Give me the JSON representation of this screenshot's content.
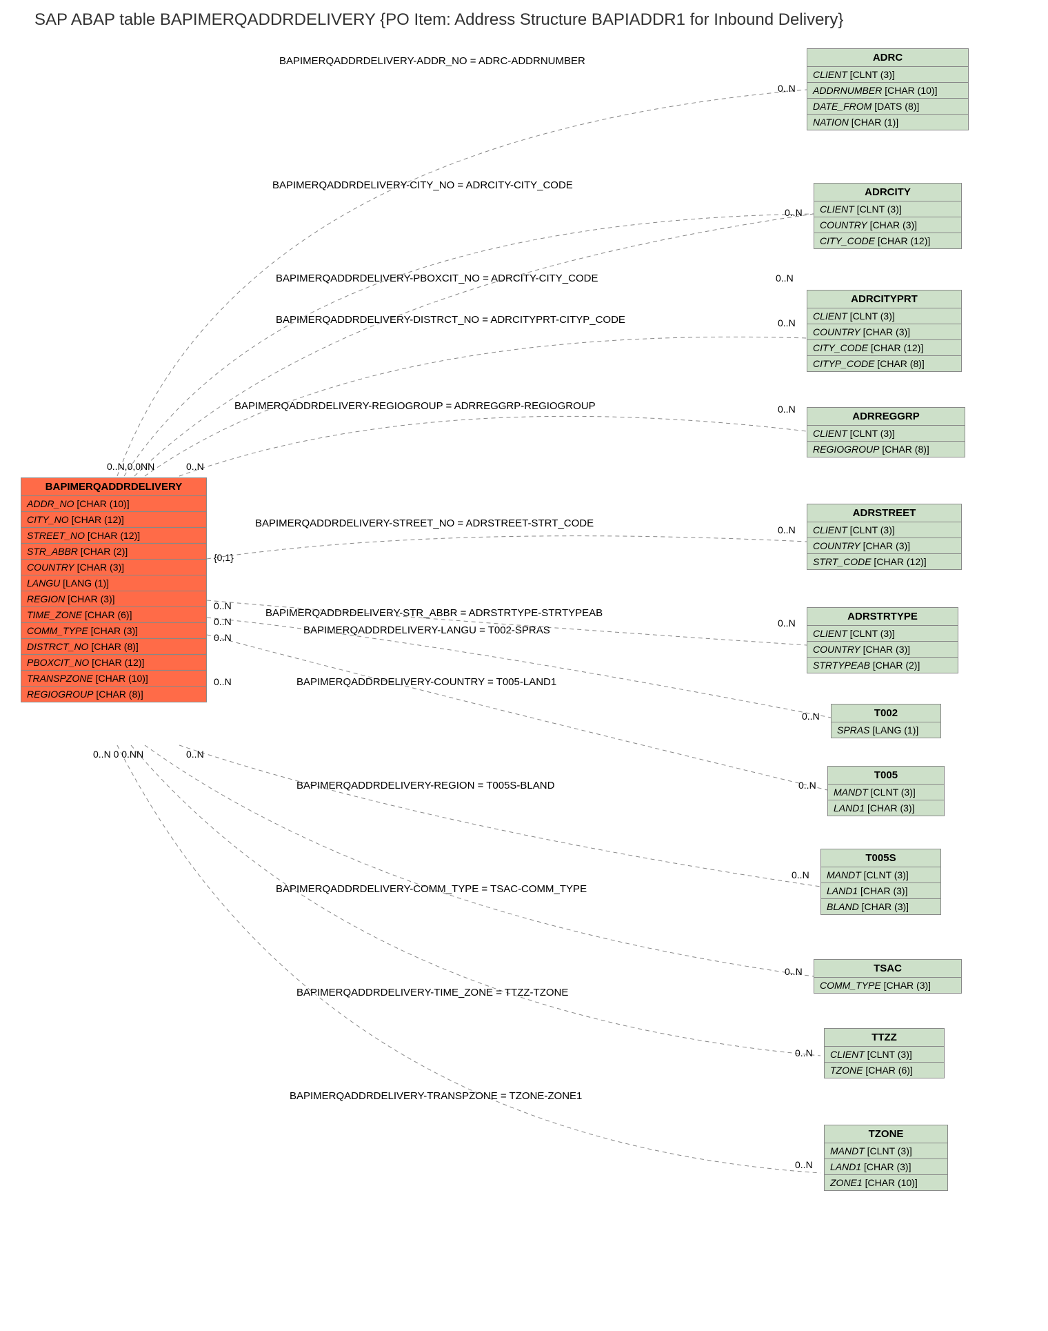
{
  "title": "SAP ABAP table BAPIMERQADDRDELIVERY {PO Item: Address Structure BAPIADDR1 for Inbound Delivery}",
  "main": {
    "name": "BAPIMERQADDRDELIVERY",
    "fields": [
      {
        "n": "ADDR_NO",
        "t": "[CHAR (10)]"
      },
      {
        "n": "CITY_NO",
        "t": "[CHAR (12)]"
      },
      {
        "n": "STREET_NO",
        "t": "[CHAR (12)]"
      },
      {
        "n": "STR_ABBR",
        "t": "[CHAR (2)]"
      },
      {
        "n": "COUNTRY",
        "t": "[CHAR (3)]"
      },
      {
        "n": "LANGU",
        "t": "[LANG (1)]"
      },
      {
        "n": "REGION",
        "t": "[CHAR (3)]"
      },
      {
        "n": "TIME_ZONE",
        "t": "[CHAR (6)]"
      },
      {
        "n": "COMM_TYPE",
        "t": "[CHAR (3)]"
      },
      {
        "n": "DISTRCT_NO",
        "t": "[CHAR (8)]"
      },
      {
        "n": "PBOXCIT_NO",
        "t": "[CHAR (12)]"
      },
      {
        "n": "TRANSPZONE",
        "t": "[CHAR (10)]"
      },
      {
        "n": "REGIOGROUP",
        "t": "[CHAR (8)]"
      }
    ]
  },
  "refs": [
    {
      "name": "ADRC",
      "fields": [
        {
          "n": "CLIENT",
          "t": "[CLNT (3)]"
        },
        {
          "n": "ADDRNUMBER",
          "t": "[CHAR (10)]"
        },
        {
          "n": "DATE_FROM",
          "t": "[DATS (8)]"
        },
        {
          "n": "NATION",
          "t": "[CHAR (1)]"
        }
      ]
    },
    {
      "name": "ADRCITY",
      "fields": [
        {
          "n": "CLIENT",
          "t": "[CLNT (3)]"
        },
        {
          "n": "COUNTRY",
          "t": "[CHAR (3)]"
        },
        {
          "n": "CITY_CODE",
          "t": "[CHAR (12)]"
        }
      ]
    },
    {
      "name": "ADRCITYPRT",
      "fields": [
        {
          "n": "CLIENT",
          "t": "[CLNT (3)]"
        },
        {
          "n": "COUNTRY",
          "t": "[CHAR (3)]"
        },
        {
          "n": "CITY_CODE",
          "t": "[CHAR (12)]"
        },
        {
          "n": "CITYP_CODE",
          "t": "[CHAR (8)]"
        }
      ]
    },
    {
      "name": "ADRREGGRP",
      "fields": [
        {
          "n": "CLIENT",
          "t": "[CLNT (3)]"
        },
        {
          "n": "REGIOGROUP",
          "t": "[CHAR (8)]"
        }
      ]
    },
    {
      "name": "ADRSTREET",
      "fields": [
        {
          "n": "CLIENT",
          "t": "[CLNT (3)]"
        },
        {
          "n": "COUNTRY",
          "t": "[CHAR (3)]"
        },
        {
          "n": "STRT_CODE",
          "t": "[CHAR (12)]"
        }
      ]
    },
    {
      "name": "ADRSTRTYPE",
      "fields": [
        {
          "n": "CLIENT",
          "t": "[CLNT (3)]"
        },
        {
          "n": "COUNTRY",
          "t": "[CHAR (3)]"
        },
        {
          "n": "STRTYPEAB",
          "t": "[CHAR (2)]"
        }
      ]
    },
    {
      "name": "T002",
      "fields": [
        {
          "n": "SPRAS",
          "t": "[LANG (1)]"
        }
      ]
    },
    {
      "name": "T005",
      "fields": [
        {
          "n": "MANDT",
          "t": "[CLNT (3)]"
        },
        {
          "n": "LAND1",
          "t": "[CHAR (3)]"
        }
      ]
    },
    {
      "name": "T005S",
      "fields": [
        {
          "n": "MANDT",
          "t": "[CLNT (3)]"
        },
        {
          "n": "LAND1",
          "t": "[CHAR (3)]"
        },
        {
          "n": "BLAND",
          "t": "[CHAR (3)]"
        }
      ]
    },
    {
      "name": "TSAC",
      "fields": [
        {
          "n": "COMM_TYPE",
          "t": "[CHAR (3)]"
        }
      ]
    },
    {
      "name": "TTZZ",
      "fields": [
        {
          "n": "CLIENT",
          "t": "[CLNT (3)]"
        },
        {
          "n": "TZONE",
          "t": "[CHAR (6)]"
        }
      ]
    },
    {
      "name": "TZONE",
      "fields": [
        {
          "n": "MANDT",
          "t": "[CLNT (3)]"
        },
        {
          "n": "LAND1",
          "t": "[CHAR (3)]"
        },
        {
          "n": "ZONE1",
          "t": "[CHAR (10)]"
        }
      ]
    }
  ],
  "rels": [
    "BAPIMERQADDRDELIVERY-ADDR_NO = ADRC-ADDRNUMBER",
    "BAPIMERQADDRDELIVERY-CITY_NO = ADRCITY-CITY_CODE",
    "BAPIMERQADDRDELIVERY-PBOXCIT_NO = ADRCITY-CITY_CODE",
    "BAPIMERQADDRDELIVERY-DISTRCT_NO = ADRCITYPRT-CITYP_CODE",
    "BAPIMERQADDRDELIVERY-REGIOGROUP = ADRREGGRP-REGIOGROUP",
    "BAPIMERQADDRDELIVERY-STREET_NO = ADRSTREET-STRT_CODE",
    "BAPIMERQADDRDELIVERY-STR_ABBR = ADRSTRTYPE-STRTYPEAB",
    "BAPIMERQADDRDELIVERY-LANGU = T002-SPRAS",
    "BAPIMERQADDRDELIVERY-COUNTRY = T005-LAND1",
    "BAPIMERQADDRDELIVERY-REGION = T005S-BLAND",
    "BAPIMERQADDRDELIVERY-COMM_TYPE = TSAC-COMM_TYPE",
    "BAPIMERQADDRDELIVERY-TIME_ZONE = TTZZ-TZONE",
    "BAPIMERQADDRDELIVERY-TRANSPZONE = TZONE-ZONE1"
  ],
  "card": {
    "zero_n": "0..N",
    "zero_one": "{0,1}",
    "top_cluster": "0..N,0,0NN",
    "bot_cluster": "0..N 0 0.NN"
  }
}
